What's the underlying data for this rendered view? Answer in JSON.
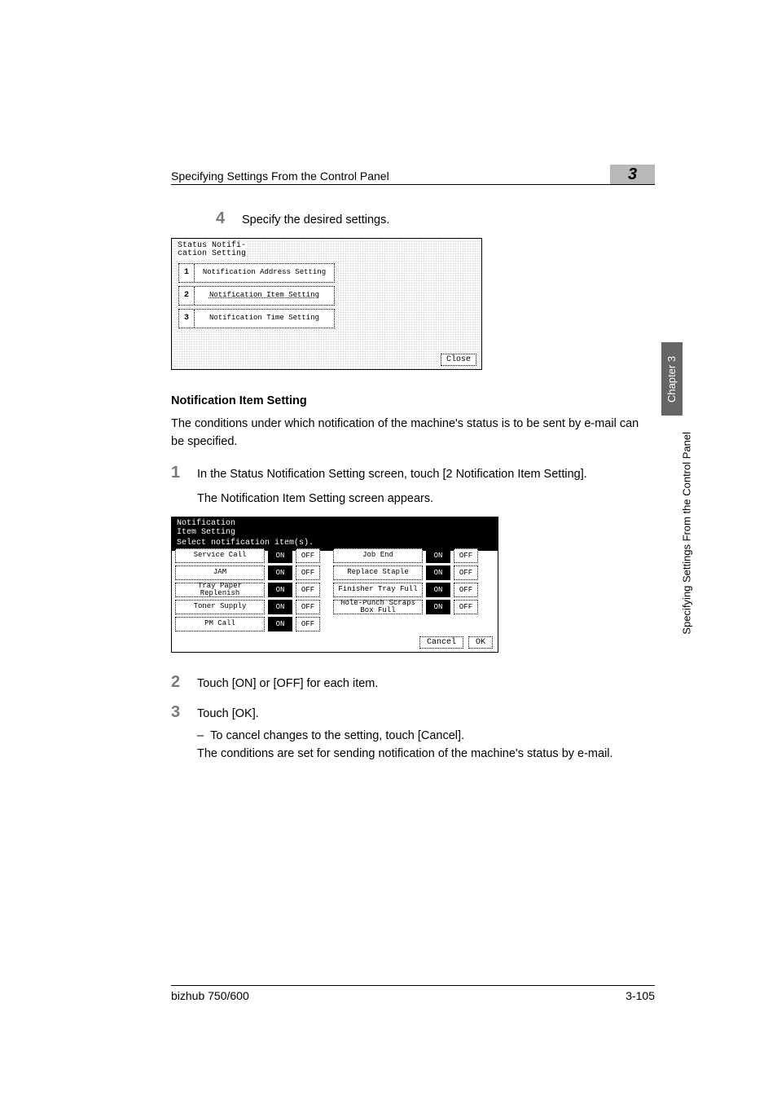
{
  "header": {
    "title": "Specifying Settings From the Control Panel",
    "chapter_number": "3"
  },
  "step4": {
    "num": "4",
    "text": "Specify the desired settings."
  },
  "lcd1": {
    "title_line1": "Status Notifi-",
    "title_line2": "cation Setting",
    "item1_num": "1",
    "item1_label": "Notification Address Setting",
    "item2_num": "2",
    "item2_label": "Notification Item Setting",
    "item3_num": "3",
    "item3_label": "Notification Time Setting",
    "close": "Close"
  },
  "section_heading": "Notification Item Setting",
  "intro_text": "The conditions under which notification of the machine's status is to be sent by e-mail can be specified.",
  "step1": {
    "num": "1",
    "text": "In the Status Notification Setting screen, touch [2 Notification Item Setting].",
    "sub": "The Notification Item Setting screen appears."
  },
  "lcd2": {
    "title_line1": "Notification",
    "title_line2": "Item Setting",
    "instruction": "Select notification item(s).",
    "on": "ON",
    "off": "OFF",
    "left_items": [
      "Service Call",
      "JAM",
      "Tray Paper Replenish",
      "Toner Supply",
      "PM Call"
    ],
    "right_items": [
      "Job End",
      "Replace Staple",
      "Finisher Tray Full",
      "Hole-Punch Scraps Box Full"
    ],
    "cancel": "Cancel",
    "ok": "OK"
  },
  "step2": {
    "num": "2",
    "text": "Touch [ON] or [OFF] for each item."
  },
  "step3": {
    "num": "3",
    "text": "Touch [OK].",
    "sub1": "To cancel changes to the setting, touch [Cancel].",
    "sub2": "The conditions are set for sending notification of the machine's status by e-mail."
  },
  "side": {
    "chapter": "Chapter 3",
    "text": "Specifying Settings From the Control Panel"
  },
  "footer": {
    "left": "bizhub 750/600",
    "right": "3-105"
  }
}
